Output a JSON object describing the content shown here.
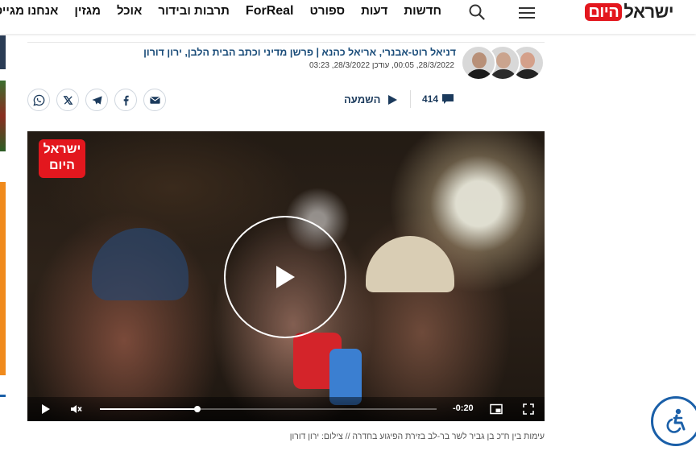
{
  "header": {
    "logo": {
      "word1": "ישראל",
      "word2": "היום"
    },
    "nav": [
      "חדשות",
      "דעות",
      "ספורט",
      "ForReal",
      "תרבות ובידור",
      "אוכל",
      "מגזין",
      "אנחנו מגייסים"
    ]
  },
  "article": {
    "authors": "דניאל רוט-אבנרי, אריאל כהנא | פרשן מדיני וכתב הבית הלבן, ירון דורון",
    "dates": "28/3/2022, 00:05, עודכן 28/3/2022, 03:23",
    "listen_label": "השמעה",
    "comment_count": "414",
    "share_icons": [
      "whatsapp-icon",
      "x-icon",
      "telegram-icon",
      "facebook-icon",
      "email-icon"
    ]
  },
  "video": {
    "logo": {
      "line1": "ישראל",
      "line2": "היום"
    },
    "time_remaining": "-0:20",
    "progress": 0.29,
    "caption": "עימות בין ח\"כ בן גביר לשר בר-לב בזירת הפיגוע בחדרה // צילום: ירון דורון"
  },
  "colors": {
    "brand_red": "#e3171e",
    "link_blue": "#1b4d7a",
    "access_blue": "#1a5fa8"
  }
}
